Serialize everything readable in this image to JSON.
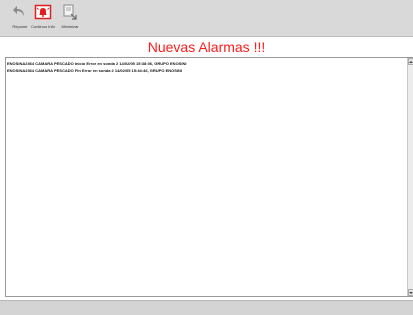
{
  "toolbar": {
    "buttons": [
      {
        "label": "Reponer",
        "icon": "undo-arrow-icon"
      },
      {
        "label": "Continuo Info",
        "icon": "alarm-bell-icon"
      },
      {
        "label": "Minimizar",
        "icon": "minimize-window-icon"
      }
    ]
  },
  "header": {
    "title": "Nuevas Alarmas !!!",
    "title_color": "#ff1a1a"
  },
  "alarms": {
    "rows": [
      "ENOSINA2364   CAMARA PESCADO   Inicio   Error en sonda 2   14/02/05 15:38:06,   GRUPO ENOSINI",
      "ENOSINA2364   CAMARA PESCADO   Fin   Error en sonda 2   14/02/05 15:44:46,   GRUPO ENOSINI"
    ]
  },
  "colors": {
    "toolbar_bg": "#d9d9d9",
    "status_bg": "#d4d4d4",
    "alarm_icon": "#e02020"
  }
}
